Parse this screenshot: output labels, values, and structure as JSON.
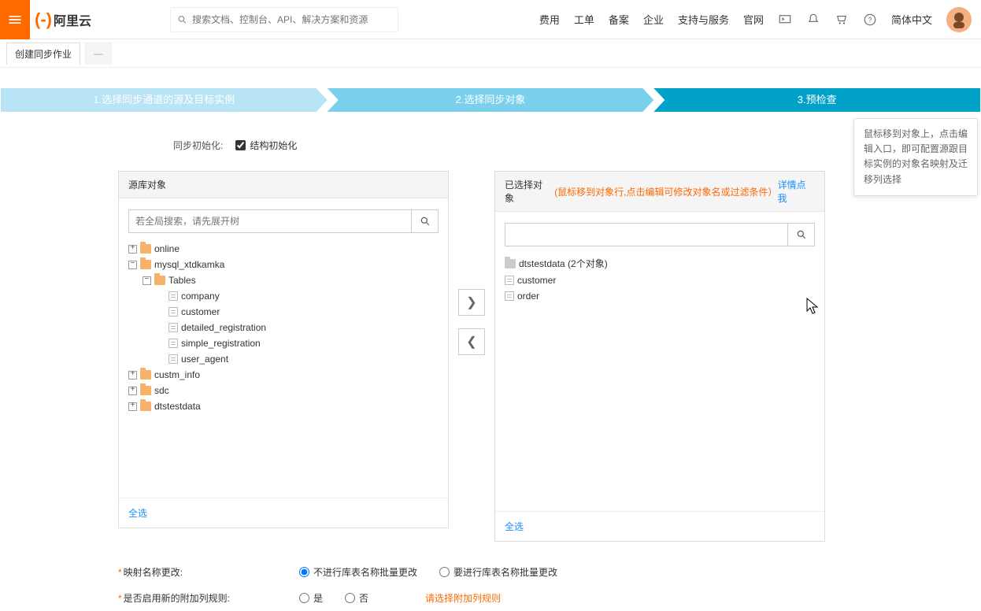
{
  "nav": {
    "brand": "阿里云",
    "search_placeholder": "搜索文档、控制台、API、解决方案和资源",
    "items": [
      "费用",
      "工单",
      "备案",
      "企业",
      "支持与服务",
      "官网"
    ],
    "lang": "简体中文"
  },
  "sub": {
    "tab": "创建同步作业",
    "code": "—"
  },
  "steps": {
    "s1": "1.选择同步通道的源及目标实例",
    "s2": "2.选择同步对象",
    "s3": "3.预检查"
  },
  "init": {
    "label": "同步初始化:",
    "cb1": "结构初始化"
  },
  "left": {
    "title": "源库对象",
    "search_placeholder": "若全局搜索，请先展开树",
    "select_all": "全选",
    "tree": {
      "online": "online",
      "mysql": "mysql_xtdkamka",
      "tables": "Tables",
      "t_company": "company",
      "t_customer": "customer",
      "t_detailed": "detailed_registration",
      "t_simple": "simple_registration",
      "t_ua": "user_agent",
      "custm": "custm_info",
      "sdc": "sdc",
      "dtstest": "dtstestdata"
    }
  },
  "right": {
    "title": "已选择对象",
    "hint": "(鼠标移到对象行,点击编辑可修改对象名或过滤条件）",
    "link": "详情点我",
    "select_all": "全选",
    "db_label": "dtstestdata (2个对象)",
    "i1": "customer",
    "i2": "order"
  },
  "form": {
    "mapping_label": "映射名称更改:",
    "mapping_opt1": "不进行库表名称批量更改",
    "mapping_opt2": "要进行库表名称批量更改",
    "extra_label": "是否启用新的附加列规则:",
    "extra_opt_yes": "是",
    "extra_opt_no": "否",
    "extra_link": "请选择附加列规则"
  },
  "tip": "鼠标移到对象上，点击编辑入口，即可配置源跟目标实例的对象名映射及迁移列选择"
}
